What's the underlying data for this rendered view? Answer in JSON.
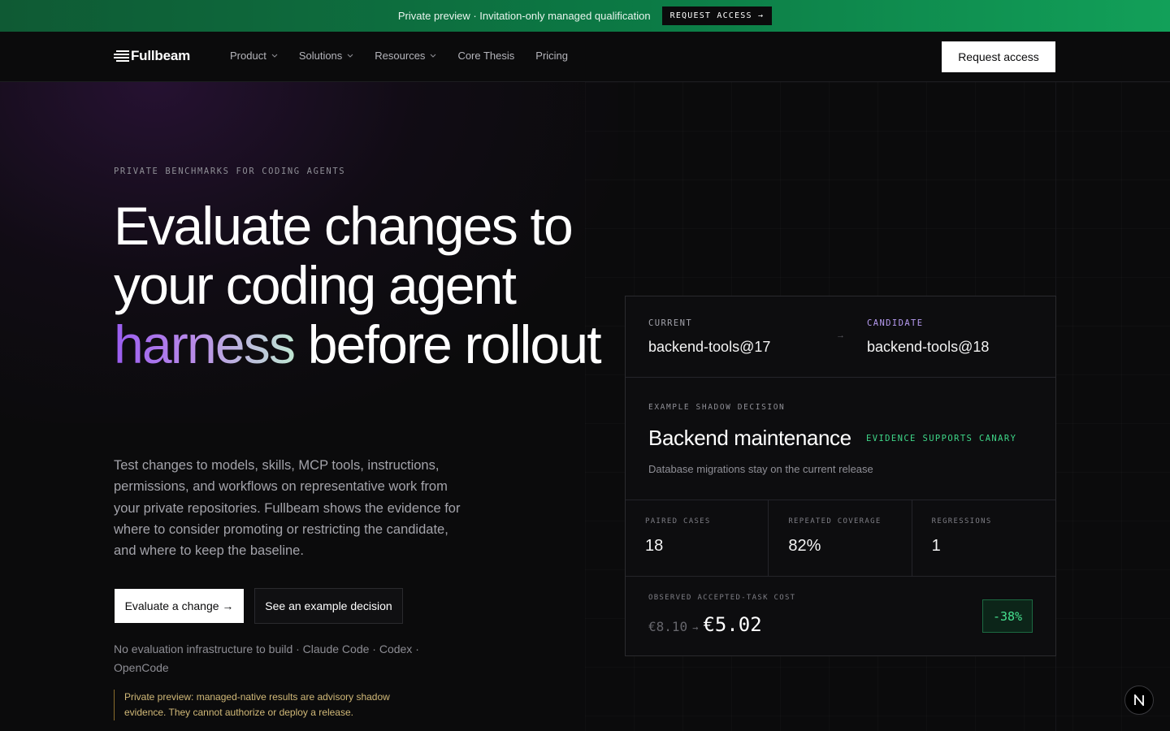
{
  "announce": {
    "text": "Private preview · Invitation-only managed qualification",
    "button_label": "REQUEST ACCESS →"
  },
  "nav": {
    "logo_text": "Fullbeam",
    "items": [
      {
        "label": "Product",
        "has_menu": true
      },
      {
        "label": "Solutions",
        "has_menu": true
      },
      {
        "label": "Resources",
        "has_menu": true
      },
      {
        "label": "Core Thesis",
        "has_menu": false
      },
      {
        "label": "Pricing",
        "has_menu": false
      }
    ],
    "cta_label": "Request access"
  },
  "hero": {
    "eyebrow": "PRIVATE BENCHMARKS FOR CODING AGENTS",
    "headline_pre": "Evaluate changes to your coding agent ",
    "headline_accent": "harness",
    "headline_post": " before rollout",
    "lede": "Test changes to models, skills, MCP tools, instructions, permissions, and workflows on representative work from your private repositories. Fullbeam shows the evidence for where to consider promoting or restricting the candidate, and where to keep the baseline.",
    "primary_cta": "Evaluate a change →",
    "secondary_cta": "See an example decision",
    "support_text": "No evaluation infrastructure to build · Claude Code · Codex · OpenCode",
    "notice": "Private preview: managed-native results are advisory shadow evidence. They cannot authorize or deploy a release."
  },
  "card": {
    "current_label": "CURRENT",
    "current_value": "backend-tools@17",
    "arrow": "→",
    "candidate_label": "CANDIDATE",
    "candidate_value": "backend-tools@18",
    "example_label": "EXAMPLE SHADOW DECISION",
    "example_title": "Backend maintenance",
    "example_status": "EVIDENCE SUPPORTS CANARY",
    "example_desc": "Database migrations stay on the current release",
    "metrics": [
      {
        "label": "PAIRED CASES",
        "value": "18"
      },
      {
        "label": "REPEATED COVERAGE",
        "value": "82%"
      },
      {
        "label": "REGRESSIONS",
        "value": "1"
      }
    ],
    "cost_label": "OBSERVED ACCEPTED-TASK COST",
    "cost_old": "€8.10",
    "cost_arrow": "→",
    "cost_new": "€5.02",
    "cost_delta": "-38%"
  },
  "colors": {
    "accent_purple": "#9a5cf0",
    "success_green": "#3ed688",
    "notice_gold": "#d1b978",
    "announce_green": "#0c7a45"
  },
  "icons": {
    "logo": "fullbeam-lines-icon",
    "menu": "chevron-down-icon",
    "floating": "n-logo-icon"
  }
}
